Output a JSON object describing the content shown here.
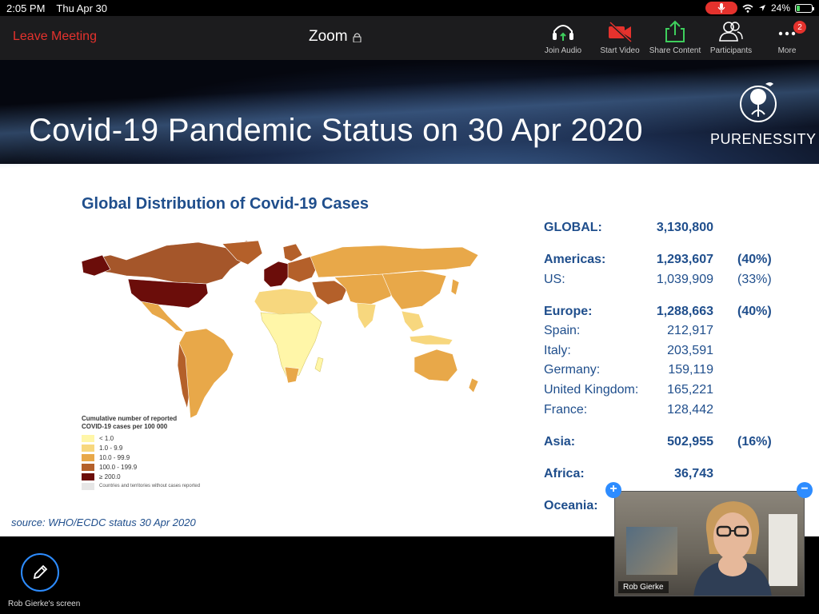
{
  "status_bar": {
    "time": "2:05 PM",
    "date": "Thu Apr 30",
    "battery": "24%",
    "battery_level": 0.24
  },
  "toolbar": {
    "leave_label": "Leave Meeting",
    "app_title": "Zoom",
    "buttons": [
      {
        "label": "Join Audio",
        "icon": "headphones-icon"
      },
      {
        "label": "Start Video",
        "icon": "video-off-icon"
      },
      {
        "label": "Share Content",
        "icon": "share-icon"
      },
      {
        "label": "Participants",
        "icon": "participants-icon"
      },
      {
        "label": "More",
        "icon": "more-icon",
        "badge": "2"
      }
    ]
  },
  "slide": {
    "title": "Covid-19 Pandemic Status on 30 Apr 2020",
    "brand": "PURENESSITY",
    "chart_title": "Global Distribution of Covid-19 Cases",
    "source": "source: WHO/ECDC status 30 Apr 2020",
    "legend": {
      "title_line1": "Cumulative number of reported",
      "title_line2": "COVID-19 cases per 100 000",
      "items": [
        {
          "label": "< 1.0",
          "color": "#fff6a8"
        },
        {
          "label": "1.0 - 9.9",
          "color": "#f7d77e"
        },
        {
          "label": "10.0 - 99.9",
          "color": "#e8a849"
        },
        {
          "label": "100.0 - 199.9",
          "color": "#b4602a"
        },
        {
          "label": "≥ 200.0",
          "color": "#6b0d0a"
        }
      ],
      "note": "Countries and territories without cases reported"
    },
    "stats": [
      {
        "label": "GLOBAL:",
        "value": "3,130,800",
        "pct": "",
        "bold": true
      },
      {
        "label": "Americas:",
        "value": "1,293,607",
        "pct": "(40%)",
        "bold": true
      },
      {
        "label": "US:",
        "value": "1,039,909",
        "pct": "(33%)",
        "bold": false
      },
      {
        "label": "Europe:",
        "value": "1,288,663",
        "pct": "(40%)",
        "bold": true
      },
      {
        "label": "Spain:",
        "value": "212,917",
        "pct": "",
        "bold": false
      },
      {
        "label": "Italy:",
        "value": "203,591",
        "pct": "",
        "bold": false
      },
      {
        "label": "Germany:",
        "value": "159,119",
        "pct": "",
        "bold": false
      },
      {
        "label": "United Kingdom:",
        "value": "165,221",
        "pct": "",
        "bold": false
      },
      {
        "label": "France:",
        "value": "128,442",
        "pct": "",
        "bold": false
      },
      {
        "label": "Asia:",
        "value": "502,955",
        "pct": "(16%)",
        "bold": true
      },
      {
        "label": "Africa:",
        "value": "36,743",
        "pct": "",
        "bold": true
      },
      {
        "label": "Oceania:",
        "value": "",
        "pct": "",
        "bold": true
      }
    ]
  },
  "bottom": {
    "screen_label": "Rob Gierke's screen",
    "participant_name": "Rob Gierke"
  }
}
